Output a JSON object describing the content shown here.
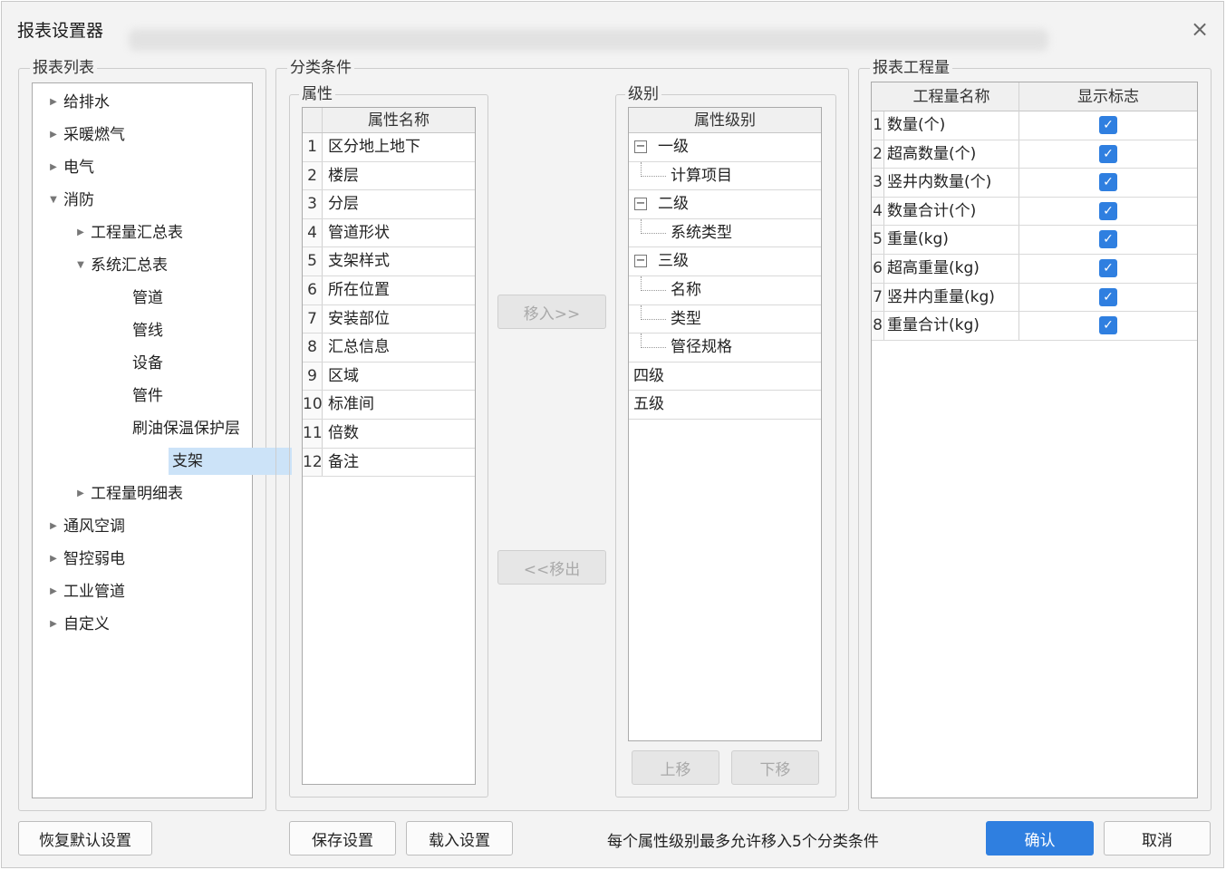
{
  "dialog": {
    "title": "报表设置器",
    "close_icon": "×"
  },
  "report_list": {
    "legend": "报表列表",
    "tree": [
      {
        "label": "给排水",
        "level": 0,
        "state": "collapsed"
      },
      {
        "label": "采暖燃气",
        "level": 0,
        "state": "collapsed"
      },
      {
        "label": "电气",
        "level": 0,
        "state": "collapsed"
      },
      {
        "label": "消防",
        "level": 0,
        "state": "expanded"
      },
      {
        "label": "工程量汇总表",
        "level": 1,
        "state": "collapsed"
      },
      {
        "label": "系统汇总表",
        "level": 1,
        "state": "expanded"
      },
      {
        "label": "管道",
        "level": 2,
        "state": "leaf"
      },
      {
        "label": "管线",
        "level": 2,
        "state": "leaf"
      },
      {
        "label": "设备",
        "level": 2,
        "state": "leaf"
      },
      {
        "label": "管件",
        "level": 2,
        "state": "leaf"
      },
      {
        "label": "刷油保温保护层",
        "level": 2,
        "state": "leaf"
      },
      {
        "label": "支架",
        "level": 2,
        "state": "leaf",
        "selected": true
      },
      {
        "label": "工程量明细表",
        "level": 1,
        "state": "collapsed"
      },
      {
        "label": "通风空调",
        "level": 0,
        "state": "collapsed"
      },
      {
        "label": "智控弱电",
        "level": 0,
        "state": "collapsed"
      },
      {
        "label": "工业管道",
        "level": 0,
        "state": "collapsed"
      },
      {
        "label": "自定义",
        "level": 0,
        "state": "collapsed"
      }
    ]
  },
  "classification": {
    "legend": "分类条件",
    "attributes": {
      "legend": "属性",
      "header": "属性名称",
      "rows": [
        {
          "n": "1",
          "name": "区分地上地下"
        },
        {
          "n": "2",
          "name": "楼层"
        },
        {
          "n": "3",
          "name": "分层"
        },
        {
          "n": "4",
          "name": "管道形状"
        },
        {
          "n": "5",
          "name": "支架样式"
        },
        {
          "n": "6",
          "name": "所在位置"
        },
        {
          "n": "7",
          "name": "安装部位"
        },
        {
          "n": "8",
          "name": "汇总信息"
        },
        {
          "n": "9",
          "name": "区域"
        },
        {
          "n": "10",
          "name": "标准间"
        },
        {
          "n": "11",
          "name": "倍数"
        },
        {
          "n": "12",
          "name": "备注"
        }
      ]
    },
    "move_in_label": "移入>>",
    "move_out_label": "<<移出",
    "levels": {
      "legend": "级别",
      "header": "属性级别",
      "rows": [
        {
          "label": "一级",
          "type": "group",
          "expander": "−"
        },
        {
          "label": "计算项目",
          "type": "child"
        },
        {
          "label": "二级",
          "type": "group",
          "expander": "−"
        },
        {
          "label": "系统类型",
          "type": "child"
        },
        {
          "label": "三级",
          "type": "group",
          "expander": "−"
        },
        {
          "label": "名称",
          "type": "child"
        },
        {
          "label": "类型",
          "type": "child"
        },
        {
          "label": "管径规格",
          "type": "child"
        },
        {
          "label": "四级",
          "type": "plain"
        },
        {
          "label": "五级",
          "type": "plain"
        }
      ],
      "up_label": "上移",
      "down_label": "下移"
    }
  },
  "quantities": {
    "legend": "报表工程量",
    "header_name": "工程量名称",
    "header_flag": "显示标志",
    "check_icon": "✓",
    "rows": [
      {
        "n": "1",
        "name": "数量(个)",
        "checked": true
      },
      {
        "n": "2",
        "name": "超高数量(个)",
        "checked": true
      },
      {
        "n": "3",
        "name": "竖井内数量(个)",
        "checked": true
      },
      {
        "n": "4",
        "name": "数量合计(个)",
        "checked": true
      },
      {
        "n": "5",
        "name": "重量(kg)",
        "checked": true
      },
      {
        "n": "6",
        "name": "超高重量(kg)",
        "checked": true
      },
      {
        "n": "7",
        "name": "竖井内重量(kg)",
        "checked": true
      },
      {
        "n": "8",
        "name": "重量合计(kg)",
        "checked": true
      }
    ]
  },
  "footer": {
    "restore_label": "恢复默认设置",
    "save_label": "保存设置",
    "load_label": "载入设置",
    "note": "每个属性级别最多允许移入5个分类条件",
    "confirm_label": "确认",
    "cancel_label": "取消"
  }
}
